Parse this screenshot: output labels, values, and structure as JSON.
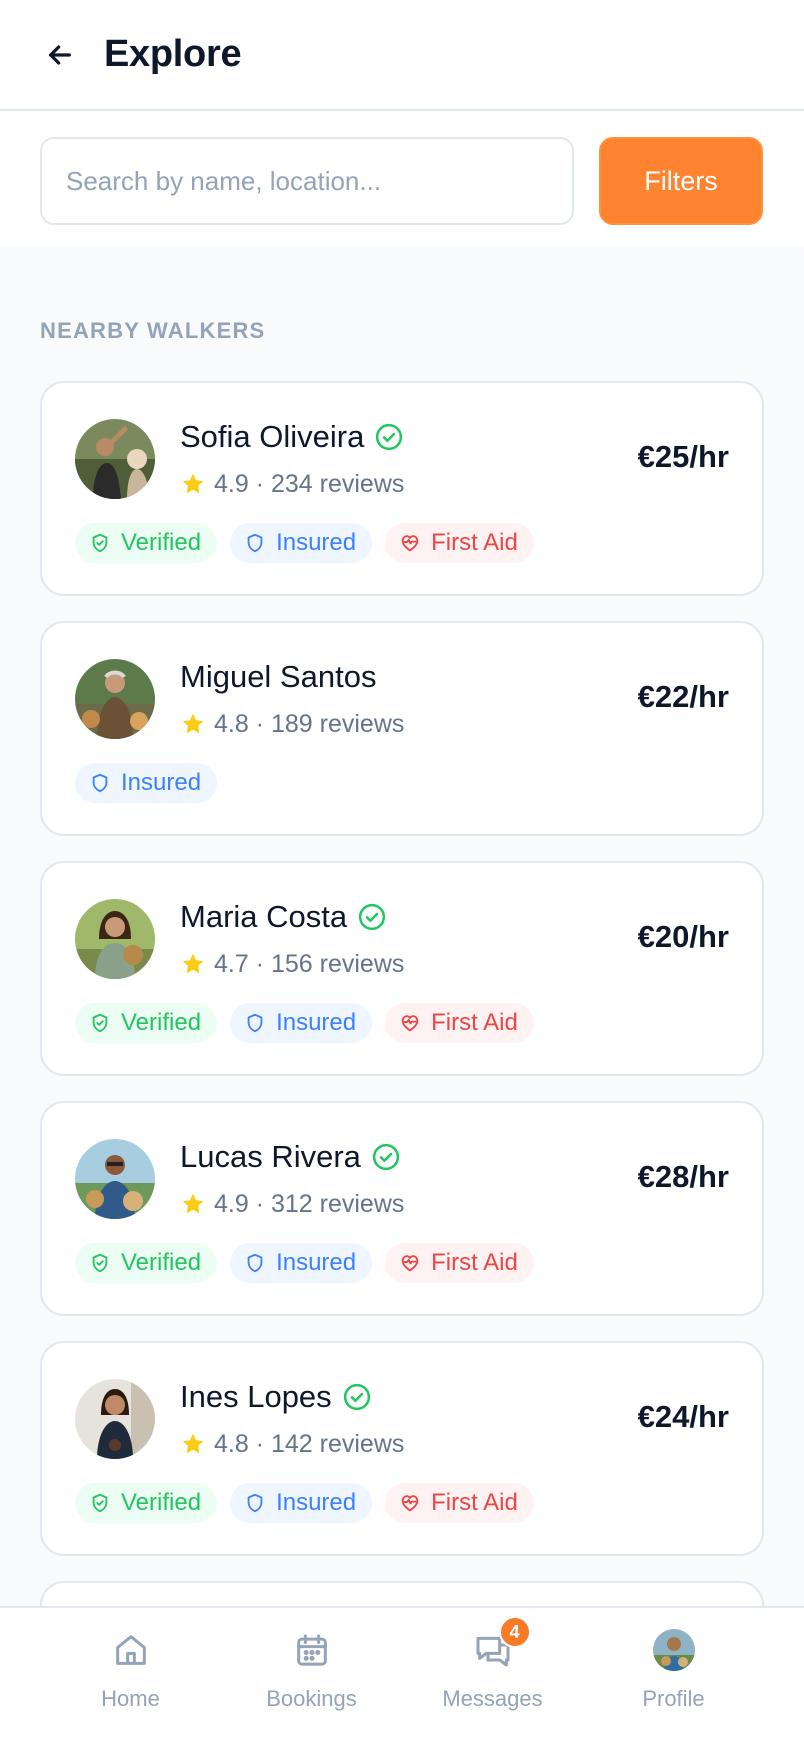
{
  "header": {
    "title": "Explore"
  },
  "search": {
    "placeholder": "Search by name, location...",
    "filters_label": "Filters"
  },
  "section": {
    "label": "NEARBY WALKERS"
  },
  "walkers": [
    {
      "name": "Sofia Oliveira",
      "verified": true,
      "rating": "4.9 · 234 reviews",
      "price": "€25/hr",
      "badges": [
        "Verified",
        "Insured",
        "First Aid"
      ]
    },
    {
      "name": "Miguel Santos",
      "verified": false,
      "rating": "4.8 · 189 reviews",
      "price": "€22/hr",
      "badges": [
        "Insured"
      ]
    },
    {
      "name": "Maria Costa",
      "verified": true,
      "rating": "4.7 · 156 reviews",
      "price": "€20/hr",
      "badges": [
        "Verified",
        "Insured",
        "First Aid"
      ]
    },
    {
      "name": "Lucas Rivera",
      "verified": true,
      "rating": "4.9 · 312 reviews",
      "price": "€28/hr",
      "badges": [
        "Verified",
        "Insured",
        "First Aid"
      ]
    },
    {
      "name": "Ines Lopes",
      "verified": true,
      "rating": "4.8 · 142 reviews",
      "price": "€24/hr",
      "badges": [
        "Verified",
        "Insured",
        "First Aid"
      ]
    }
  ],
  "nav": {
    "items": [
      {
        "label": "Home",
        "icon": "home-icon"
      },
      {
        "label": "Bookings",
        "icon": "calendar-icon"
      },
      {
        "label": "Messages",
        "icon": "chat-icon",
        "badge": "4"
      },
      {
        "label": "Profile",
        "icon": "avatar"
      }
    ]
  },
  "colors": {
    "accent": "#ff8330",
    "verified": "#22c55e",
    "insured": "#3b82f6",
    "first_aid": "#ef4444",
    "star": "#facc15"
  }
}
